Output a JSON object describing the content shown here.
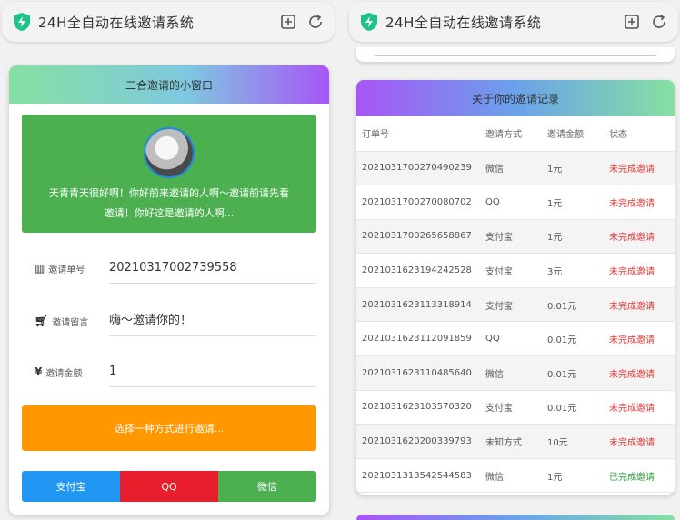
{
  "app": {
    "title": "24H全自动在线邀请系统",
    "accent": "#1ec28b"
  },
  "left": {
    "header": "二合邀请的小窗口",
    "greeting": "天青青天很好啊！你好前来邀请的人啊～邀请前请先看",
    "greeting2": "邀请！你好这是邀请的人啊...",
    "fields": [
      {
        "label": "邀请单号",
        "icon": "barcode-icon",
        "value": "20210317002739558"
      },
      {
        "label": "邀请留言",
        "icon": "cart-icon",
        "value": "嗨～邀请你的！"
      },
      {
        "label": "邀请金额",
        "icon": "yen-icon",
        "value": "1"
      }
    ],
    "choose_button": "选择一种方式进行邀请...",
    "pay_buttons": [
      "支付宝",
      "QQ",
      "微信"
    ]
  },
  "right": {
    "header": "关于你的邀请记录",
    "columns": [
      "订单号",
      "邀请方式",
      "邀请金额",
      "状态"
    ],
    "rows": [
      {
        "id": "20210317002704902​39",
        "method": "微信",
        "amount": "1元",
        "status": "未完成邀请"
      },
      {
        "id": "20210317002700807​02",
        "method": "QQ",
        "amount": "1元",
        "status": "未完成邀请"
      },
      {
        "id": "20210317002656588​67",
        "method": "支付宝",
        "amount": "1元",
        "status": "未完成邀请"
      },
      {
        "id": "20210316231942425​28",
        "method": "支付宝",
        "amount": "3元",
        "status": "未完成邀请"
      },
      {
        "id": "20210316231133189​14",
        "method": "支付宝",
        "amount": "0.01元",
        "status": "未完成邀请"
      },
      {
        "id": "20210316231120918​59",
        "method": "QQ",
        "amount": "0.01元",
        "status": "未完成邀请"
      },
      {
        "id": "20210316231104856​40",
        "method": "微信",
        "amount": "0.01元",
        "status": "未完成邀请"
      },
      {
        "id": "20210316231035703​20",
        "method": "支付宝",
        "amount": "0.01元",
        "status": "未完成邀请"
      },
      {
        "id": "20210316202003397​93",
        "method": "未知方式",
        "amount": "10元",
        "status": "未完成邀请"
      },
      {
        "id": "20210313135425445​83",
        "method": "微信",
        "amount": "1元",
        "status": "已完成邀请"
      }
    ]
  }
}
